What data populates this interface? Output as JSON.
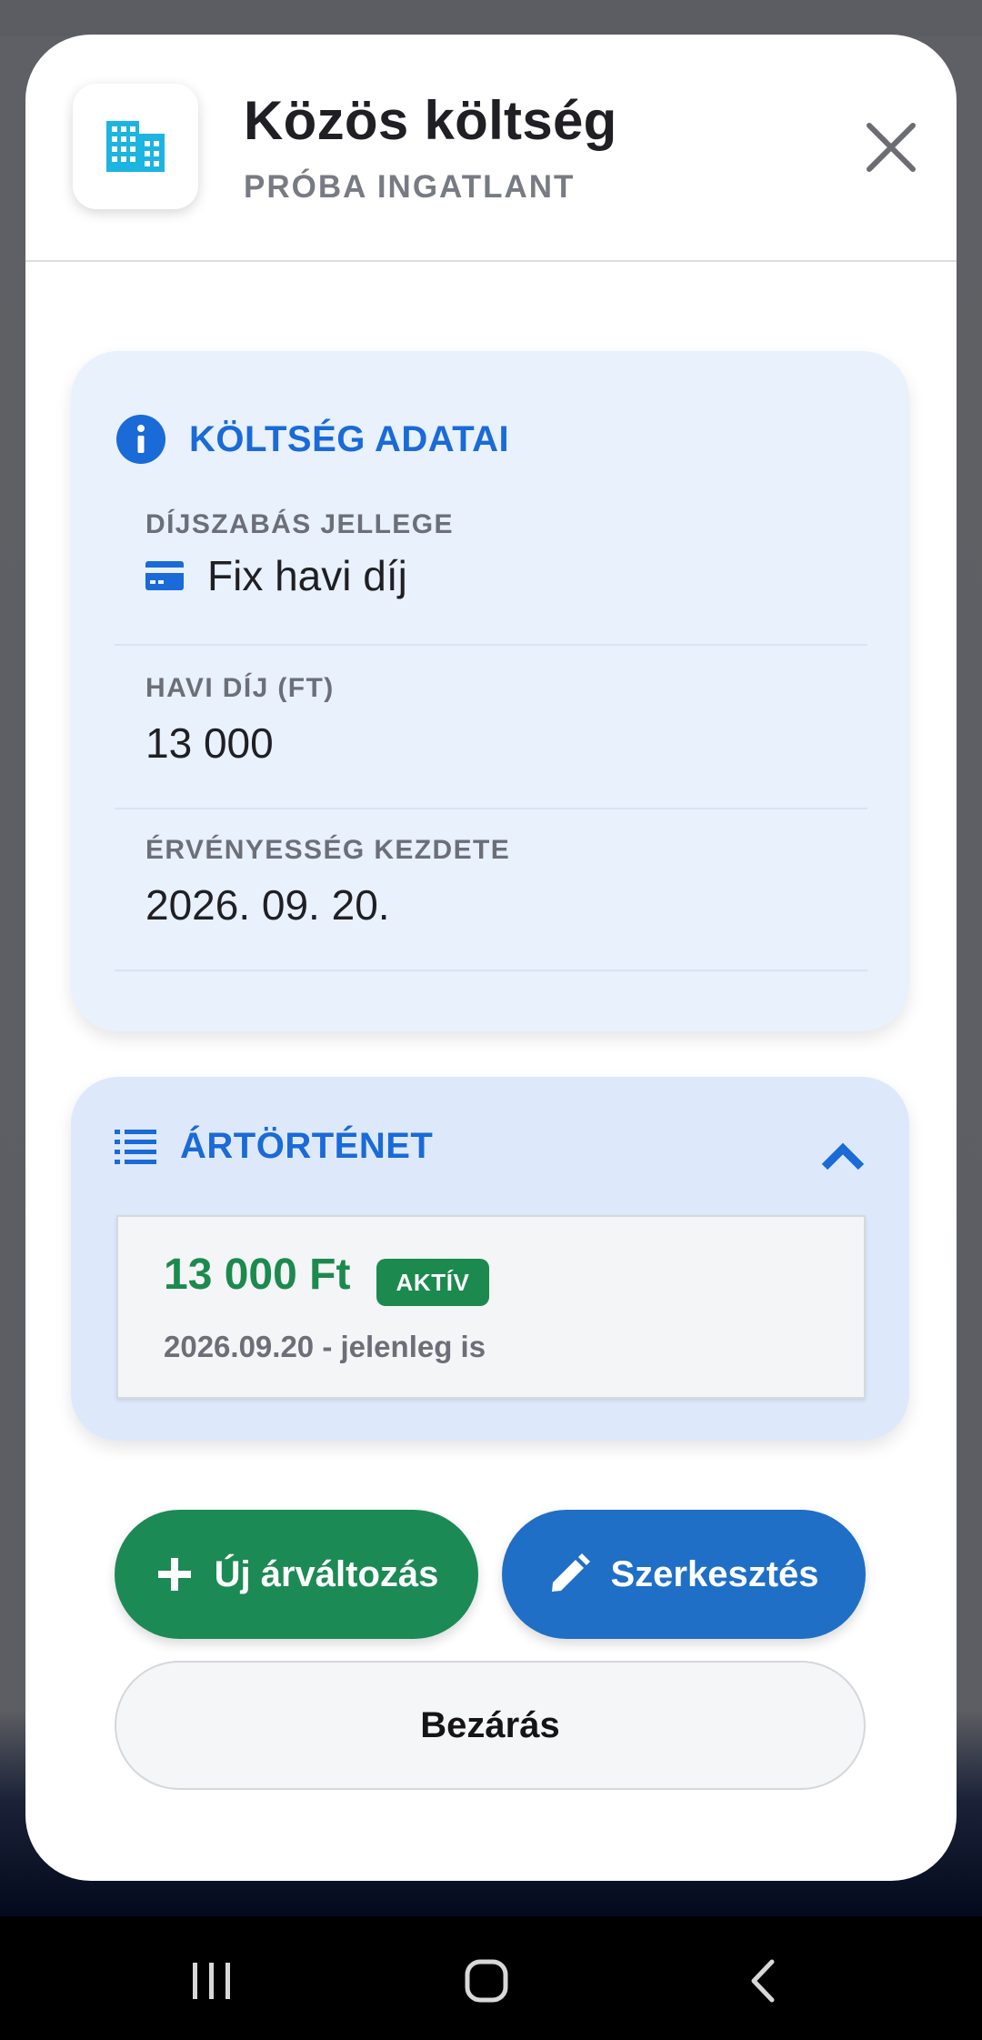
{
  "app": {
    "title": "Közös költség",
    "subtitle": "PRÓBA INGATLANT",
    "icon": "building-icon",
    "close_icon": "close-icon"
  },
  "details": {
    "section_title": "KÖLTSÉG ADATAI",
    "section_icon": "info-icon",
    "fields": [
      {
        "label": "DÍJSZABÁS JELLEGE",
        "value": "Fix havi díj",
        "icon": "card-icon"
      },
      {
        "label": "HAVI DÍJ (FT)",
        "value": "13 000"
      },
      {
        "label": "ÉRVÉNYESSÉG KEZDETE",
        "value": "2026. 09. 20."
      }
    ]
  },
  "history": {
    "section_title": "ÁRTÖRTÉNET",
    "section_icon": "list-icon",
    "expanded": true,
    "items": [
      {
        "price": "13 000 Ft",
        "badge": "AKTÍV",
        "period": "2026.09.20 - jelenleg is"
      }
    ]
  },
  "actions": {
    "new_price_label": "Új árváltozás",
    "edit_label": "Szerkesztés",
    "close_label": "Bezárás"
  },
  "colors": {
    "accent_blue": "#1a6ad8",
    "success_green": "#1c8a4f",
    "edit_blue": "#1f6fc7",
    "info_card_bg": "#e8f1fc",
    "history_card_bg": "#dde9fb",
    "building_icon": "#1cb4e0"
  },
  "system_nav": {
    "recents_icon": "recents-icon",
    "home_icon": "home-icon",
    "back_icon": "back-icon"
  }
}
